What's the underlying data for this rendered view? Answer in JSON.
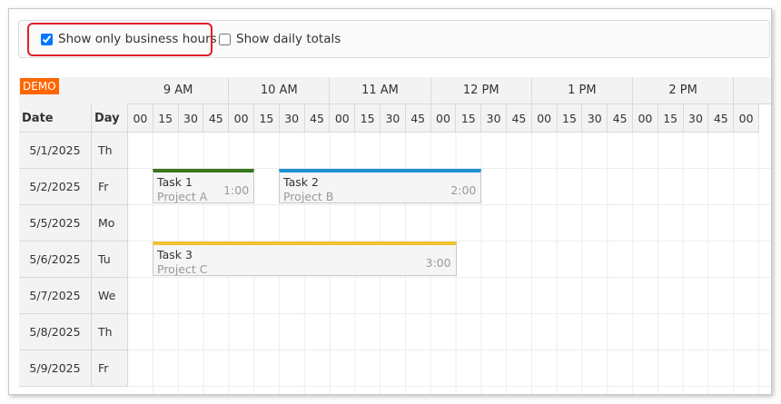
{
  "toolbar": {
    "business_hours": {
      "label": "Show only business hours",
      "checked": true
    },
    "daily_totals": {
      "label": "Show daily totals",
      "checked": false
    },
    "highlight_color": "#e0202a"
  },
  "scheduler": {
    "demo_badge": "DEMO",
    "headers": {
      "date": "Date",
      "day": "Day"
    },
    "hours": [
      "9 AM",
      "10 AM",
      "11 AM",
      "12 PM",
      "1 PM",
      "2 PM"
    ],
    "minutes": [
      "00",
      "15",
      "30",
      "45"
    ],
    "trailing_minute": "00",
    "rows": [
      {
        "date": "5/1/2025",
        "day": "Th"
      },
      {
        "date": "5/2/2025",
        "day": "Fr"
      },
      {
        "date": "5/5/2025",
        "day": "Mo"
      },
      {
        "date": "5/6/2025",
        "day": "Tu"
      },
      {
        "date": "5/7/2025",
        "day": "We"
      },
      {
        "date": "5/8/2025",
        "day": "Th"
      },
      {
        "date": "5/9/2025",
        "day": "Fr"
      }
    ],
    "events": [
      {
        "title": "Task 1",
        "project": "Project A",
        "duration": "1:00",
        "row": 1,
        "start": "9:00",
        "end": "10:00",
        "color": "#38761d"
      },
      {
        "title": "Task 2",
        "project": "Project B",
        "duration": "2:00",
        "row": 1,
        "start": "10:15",
        "end": "12:15",
        "color": "#1e90d0"
      },
      {
        "title": "Task 3",
        "project": "Project C",
        "duration": "3:00",
        "row": 3,
        "start": "9:00",
        "end": "12:00",
        "color": "#f1c232"
      }
    ]
  }
}
